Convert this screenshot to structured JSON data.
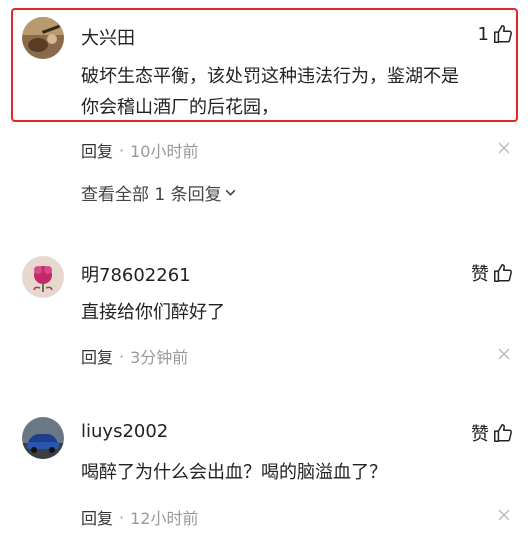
{
  "comments": [
    {
      "username": "大兴田",
      "like_text": "1",
      "content_lines": [
        "破坏生态平衡，该处罚这种违法行为，鉴湖不是",
        "你会稽山酒厂的后花园，"
      ],
      "reply_label": "回复",
      "separator": "·",
      "time": "10小时前",
      "view_all": "查看全部 1 条回复",
      "avatar_icon": "avatar-guitar-photo"
    },
    {
      "username": "明78602261",
      "like_text": "赞",
      "content_lines": [
        "直接给你们醉好了"
      ],
      "reply_label": "回复",
      "separator": "·",
      "time": "3分钟前",
      "avatar_icon": "avatar-pink-flower"
    },
    {
      "username": "liuys2002",
      "like_text": "赞",
      "content_lines": [
        "喝醉了为什么会出血？喝的脑溢血了？"
      ],
      "reply_label": "回复",
      "separator": "·",
      "time": "12小时前",
      "avatar_icon": "avatar-blue-car"
    }
  ],
  "colors": {
    "highlight": "#e02626",
    "muted": "#999999",
    "text": "#222222"
  }
}
